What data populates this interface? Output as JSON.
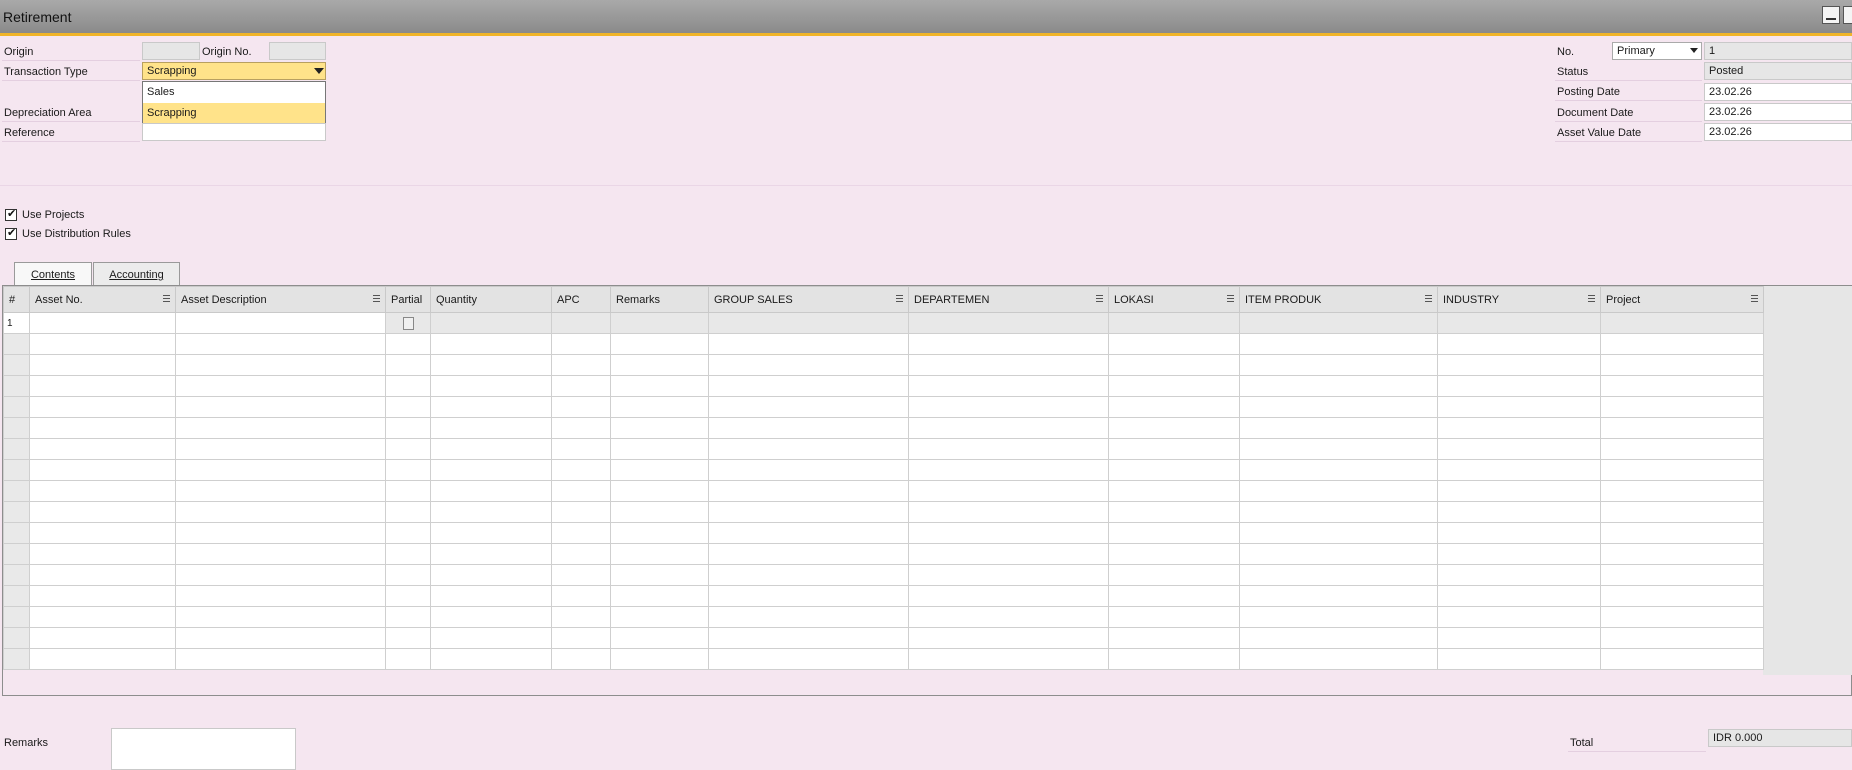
{
  "window": {
    "title": "Retirement"
  },
  "header_left": {
    "origin_label": "Origin",
    "origin_value": "",
    "origin_no_label": "Origin No.",
    "origin_no_value": "",
    "transaction_type_label": "Transaction Type",
    "transaction_type_value": "Scrapping",
    "transaction_type_options": [
      "Sales",
      "Scrapping"
    ],
    "depreciation_area_label": "Depreciation Area",
    "reference_label": "Reference",
    "reference_value": ""
  },
  "header_right": {
    "no_label": "No.",
    "series_value": "Primary",
    "no_value": "1",
    "status_label": "Status",
    "status_value": "Posted",
    "posting_date_label": "Posting Date",
    "posting_date_value": "23.02.26",
    "document_date_label": "Document Date",
    "document_date_value": "23.02.26",
    "asset_value_date_label": "Asset Value Date",
    "asset_value_date_value": "23.02.26"
  },
  "options": {
    "use_projects_label": "Use Projects",
    "use_projects_checked": true,
    "use_distribution_rules_label": "Use Distribution Rules",
    "use_distribution_rules_checked": true
  },
  "tabs": [
    {
      "label": "Contents",
      "active": true
    },
    {
      "label": "Accounting",
      "active": false
    }
  ],
  "grid": {
    "columns": [
      "#",
      "Asset No.",
      "Asset Description",
      "Partial",
      "Quantity",
      "APC",
      "Remarks",
      "GROUP SALES",
      "DEPARTEMEN",
      "LOKASI",
      "ITEM PRODUK",
      "INDUSTRY",
      "Project"
    ],
    "first_row_number": "1"
  },
  "footer": {
    "remarks_label": "Remarks",
    "remarks_value": "",
    "total_label": "Total",
    "total_value": "IDR 0.000"
  }
}
